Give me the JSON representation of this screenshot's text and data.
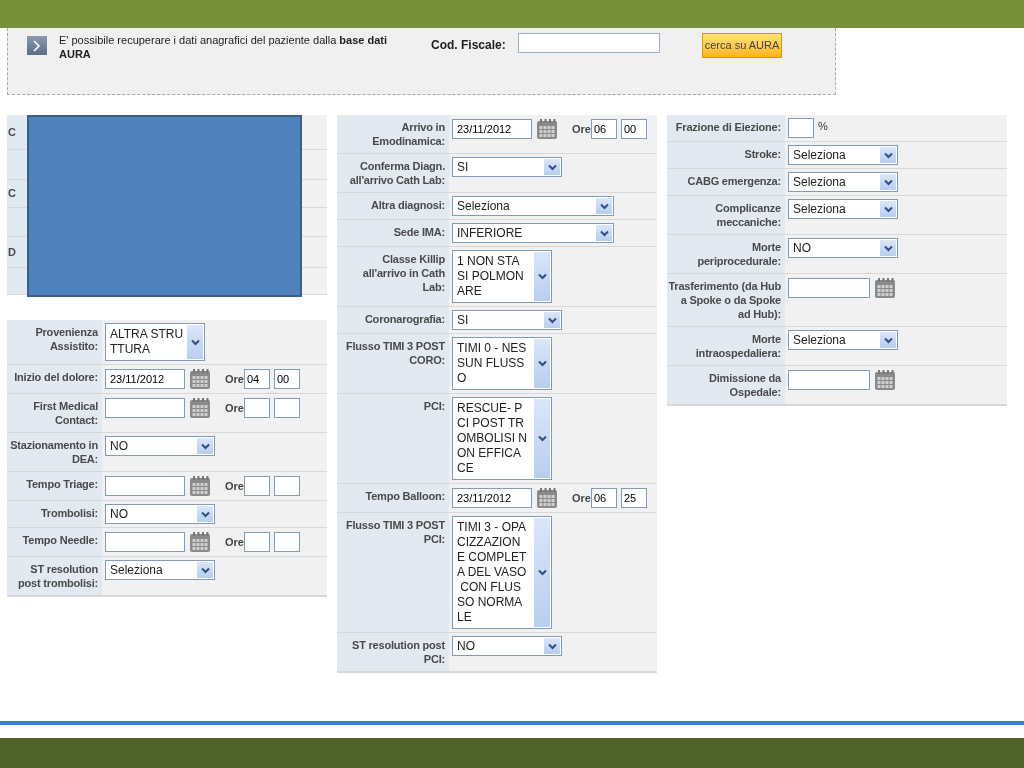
{
  "aura_panel": {
    "text": "E' possibile recuperare i dati anagrafici del paziente dalla **base dati AURA**",
    "cf_label": "Cod. Fiscale:",
    "button": "cerca su AURA"
  },
  "covered_table": {
    "rows": [
      {
        "label": "C"
      },
      {},
      {
        "label": "C"
      },
      {},
      {
        "label": "D"
      },
      {}
    ]
  },
  "columns": [
    {
      "rows": [
        {
          "label": "Provenienza Assistito:",
          "kind": "listbox",
          "lines": [
            "ALTRA STRU",
            "TTURA"
          ]
        },
        {
          "label": "Inizio del dolore:",
          "kind": "datetime",
          "date": "23/11/2012",
          "ore_label": "Ore",
          "hour": "04",
          "minute": "00"
        },
        {
          "label": "First Medical Contact:",
          "kind": "datetime",
          "ore_label": "Ore"
        },
        {
          "label": "Stazionamento in DEA:",
          "kind": "select",
          "value": "NO"
        },
        {
          "label": "Tempo Triage:",
          "kind": "datetime",
          "ore_label": "Ore"
        },
        {
          "label": "Trombolisi:",
          "kind": "select",
          "value": "NO"
        },
        {
          "label": "Tempo Needle:",
          "kind": "datetime",
          "ore_label": "Ore"
        },
        {
          "label": "ST resolution post trombolisi:",
          "kind": "select",
          "value": "Seleziona"
        }
      ]
    },
    {
      "rows": [
        {
          "label": "Arrivo in Emodinamica:",
          "kind": "datetime",
          "date": "23/11/2012",
          "ore_label": "Ore",
          "hour": "06",
          "minute": "00"
        },
        {
          "label": "Conferma Diagn. all'arrivo Cath Lab:",
          "kind": "select",
          "value": "SI"
        },
        {
          "label": "Altra diagnosi:",
          "kind": "select_wide",
          "value": "Seleziona"
        },
        {
          "label": "Sede IMA:",
          "kind": "select_wide",
          "value": "INFERIORE"
        },
        {
          "label": "Classe Killip all'arrivo in Cath Lab:",
          "kind": "listbox",
          "lines": [
            "1 NON STA",
            "SI POLMON",
            "ARE"
          ]
        },
        {
          "label": "Coronarografia:",
          "kind": "select",
          "value": "SI"
        },
        {
          "label": "Flusso TIMI 3 POST CORO:",
          "kind": "listbox",
          "lines": [
            "TIMI 0 - NES",
            "SUN FLUSS",
            "O"
          ]
        },
        {
          "label": "PCI:",
          "kind": "listbox",
          "lines": [
            "RESCUE- P",
            "CI POST TR",
            "OMBOLISI N",
            "ON EFFICA",
            "CE"
          ]
        },
        {
          "label": "Tempo Balloon:",
          "kind": "datetime",
          "date": "23/11/2012",
          "ore_label": "Ore",
          "hour": "06",
          "minute": "25"
        },
        {
          "label": "Flusso TIMI 3 POST PCI:",
          "kind": "listbox",
          "lines": [
            "TIMI 3 - OPA",
            "CIZZAZION",
            "E COMPLET",
            "A DEL VASO",
            " CON FLUS",
            "SO NORMA",
            "LE"
          ]
        },
        {
          "label": "ST resolution post PCI:",
          "kind": "select",
          "value": "NO"
        }
      ]
    },
    {
      "rows": [
        {
          "label": "Frazione di Eiezione:",
          "kind": "percent",
          "unit": "%"
        },
        {
          "label": "Stroke:",
          "kind": "select",
          "value": "Seleziona"
        },
        {
          "label": "CABG emergenza:",
          "kind": "select",
          "value": "Seleziona"
        },
        {
          "label": "Complicanze meccaniche:",
          "kind": "select",
          "value": "Seleziona"
        },
        {
          "label": "Morte periprocedurale:",
          "kind": "select",
          "value": "NO"
        },
        {
          "label": "Trasferimento (da Hub a Spoke o da Spoke ad Hub):",
          "kind": "date"
        },
        {
          "label": "Morte intraospedaliera:",
          "kind": "select",
          "value": "Seleziona"
        },
        {
          "label": "Dimissione da Ospedale:",
          "kind": "date"
        }
      ]
    }
  ]
}
